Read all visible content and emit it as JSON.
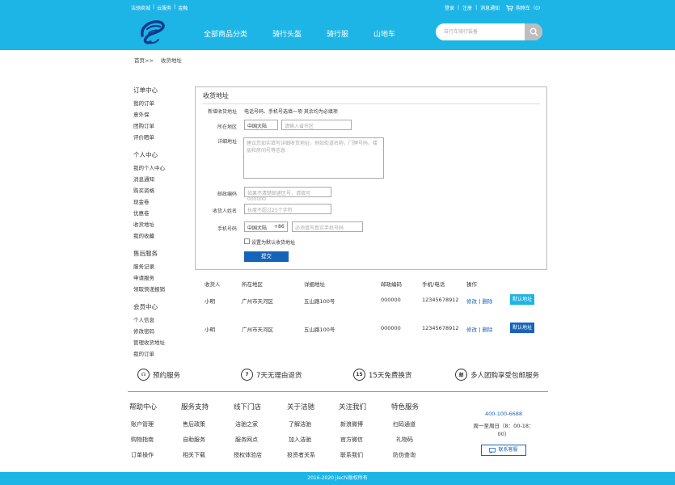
{
  "topbar": {
    "links_left": [
      "洁驰商城",
      "|",
      "云服务",
      "|",
      "金融"
    ],
    "login": "登录",
    "sep": "|",
    "register": "注册",
    "messages": "消息通知",
    "cart": "购物车（0）"
  },
  "nav": {
    "items": [
      "全部商品分类",
      "骑行头盔",
      "骑行服",
      "山地车"
    ],
    "search_placeholder": "自行车骑行装备"
  },
  "breadcrumb": {
    "home": "首页>>",
    "current": "收货地址"
  },
  "sidebar": [
    {
      "title": "订单中心",
      "items": [
        "我的订单",
        "意外保",
        "团购订单",
        "评价晒单"
      ]
    },
    {
      "title": "个人中心",
      "items": [
        "我的个人中心",
        "消息通知",
        "购买资格",
        "现金卷",
        "优惠卷",
        "收货地址",
        "我的收藏"
      ]
    },
    {
      "title": "售后服务",
      "items": [
        "服务记录",
        "申请服务",
        "领取快递报销"
      ]
    },
    {
      "title": "会员中心",
      "items": [
        "个人信息",
        "修改密码",
        "管理收货地址",
        "我的订单"
      ]
    }
  ],
  "form": {
    "title": "收货地址",
    "new_label": "新增收货地址",
    "new_note": "电话号码、手机号选填一项 其余均为必填项",
    "region_label": "所在地区",
    "region_value": "中国大陆",
    "region_placeholder": "请输入省市区",
    "detail_label": "详细地址",
    "detail_placeholder": "建议您如实填写详细收货地址，例如街道名称，门牌号码，楼层和房间号等信息",
    "zip_label": "邮政编码",
    "zip_placeholder": "如果不清楚邮递区号，请填写000000",
    "name_label": "收货人姓名",
    "name_placeholder": "长度不超过25个字符",
    "phone_label": "手机号码",
    "phone_region": "中国大陆",
    "phone_code": "+86",
    "phone_placeholder": "必须填写真实手机号码",
    "default_label": "设置为默认收货地址",
    "submit": "提交"
  },
  "table": {
    "headers": [
      "收货人",
      "所在地区",
      "详细地址",
      "邮政编码",
      "手机/电话",
      "操作"
    ],
    "rows": [
      {
        "name": "小明",
        "region": "广州市天河区",
        "address": "五山路100号",
        "zip": "000000",
        "phone": "12345678912",
        "edit": "修改",
        "sep": "|",
        "del": "删除",
        "default": "默认地址"
      },
      {
        "name": "小明",
        "region": "广州市天河区",
        "address": "五山路100号",
        "zip": "000000",
        "phone": "12345678912",
        "edit": "修改",
        "sep": "|",
        "del": "删除",
        "default": "默认地址"
      }
    ],
    "default_colors": [
      "#1cb5e6",
      "#1664b8"
    ]
  },
  "services": [
    {
      "icon": "headset-icon",
      "glyph": "☊",
      "text": "预约服务"
    },
    {
      "icon": "seven-day-icon",
      "glyph": "7",
      "text": "7天无理由退货"
    },
    {
      "icon": "fifteen-day-icon",
      "glyph": "15",
      "text": "15天免费换货"
    },
    {
      "icon": "mail-icon",
      "glyph": "邮",
      "text": "多人团购享受包邮服务"
    }
  ],
  "footer": {
    "columns": [
      {
        "title": "帮助中心",
        "links": [
          "账户管理",
          "购物指南",
          "订单操作"
        ]
      },
      {
        "title": "服务支持",
        "links": [
          "售后政策",
          "自助服务",
          "相关下载"
        ]
      },
      {
        "title": "线下门店",
        "links": [
          "洁驰之家",
          "服务网点",
          "授权体验店"
        ]
      },
      {
        "title": "关于洁驰",
        "links": [
          "了解洁驰",
          "加入洁驰",
          "投资者关系"
        ]
      },
      {
        "title": "关注我们",
        "links": [
          "新浪微博",
          "官方微信",
          "联系我们"
        ]
      },
      {
        "title": "特色服务",
        "links": [
          "扫码通道",
          "礼物码",
          "防伪查询"
        ]
      }
    ],
    "phone": "400-100-6688",
    "hours": "周一至周日（8：00-18：00）",
    "service_btn": "联系客服",
    "copyright": "2016-2020 jiechi版权所有"
  },
  "colors": {
    "brand": "#1cb5e6",
    "accent": "#1664b8"
  }
}
